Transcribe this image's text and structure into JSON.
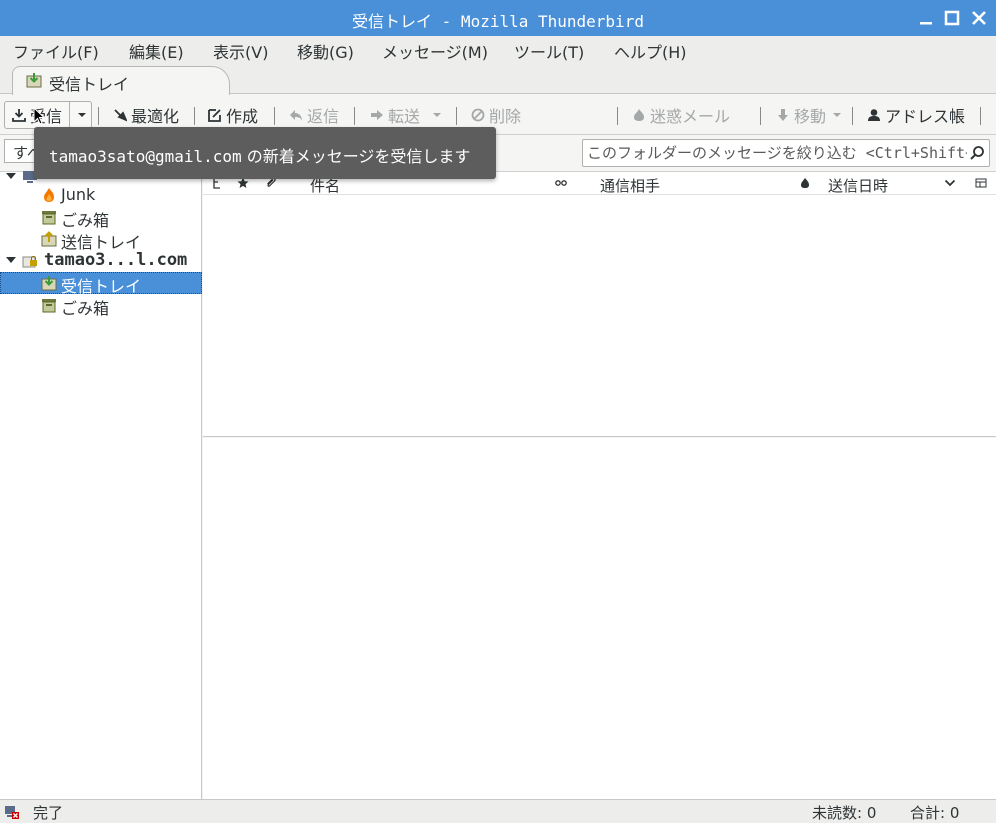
{
  "window": {
    "title": "受信トレイ - Mozilla Thunderbird"
  },
  "menubar": {
    "items": [
      "ファイル(F)",
      "編集(E)",
      "表示(V)",
      "移動(G)",
      "メッセージ(M)",
      "ツール(T)",
      "ヘルプ(H)"
    ]
  },
  "tabs": [
    {
      "label": "受信トレイ",
      "icon": "inbox-icon"
    }
  ],
  "toolbar": {
    "get_mail": "受信",
    "compact": "最適化",
    "write": "作成",
    "reply": "返信",
    "forward": "転送",
    "delete": "削除",
    "junk": "迷惑メール",
    "move": "移動",
    "address_book": "アドレス帳"
  },
  "filter": {
    "quick_filter_partial": "すべ",
    "search_placeholder": "このフォルダーのメッセージを絞り込む <Ctrl+Shift+K>"
  },
  "folders": [
    {
      "label": "Junk",
      "icon": "junk-fire-icon",
      "level": 1
    },
    {
      "label": "ごみ箱",
      "icon": "trash-icon",
      "level": 1
    },
    {
      "label": "送信トレイ",
      "icon": "outbox-icon",
      "level": 1
    },
    {
      "label": "tamao3...l.com",
      "icon": "mail-account-icon",
      "level": 0
    },
    {
      "label": "受信トレイ",
      "icon": "inbox-icon",
      "level": 1,
      "selected": true
    },
    {
      "label": "ごみ箱",
      "icon": "trash-icon",
      "level": 1
    }
  ],
  "thread_columns": {
    "subject": "件名",
    "correspondent": "通信相手",
    "date": "送信日時"
  },
  "tooltip": {
    "email": "tamao3sato@gmail.com",
    "text": " の新着メッセージを受信します"
  },
  "status": {
    "text": "完了",
    "unread": "未読数: 0",
    "total": "合計: 0"
  },
  "colors": {
    "titlebar": "#4a90d9",
    "selection": "#4a90d9",
    "tooltip_bg": "#5d5d5d"
  }
}
